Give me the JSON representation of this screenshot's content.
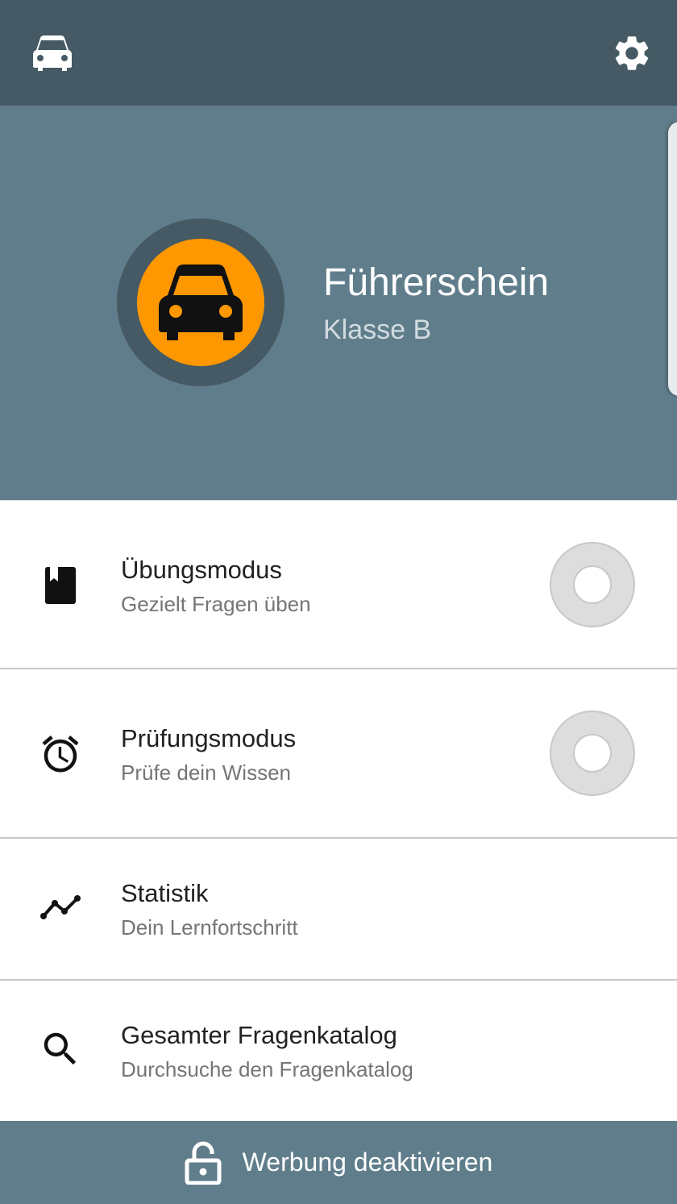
{
  "colors": {
    "toolbar_bg": "#455a64",
    "header_bg": "#607d8b",
    "accent": "#ff9800",
    "footer_bg": "#607d8b",
    "progress_ring": "#dddddd"
  },
  "toolbar": {
    "left_icon": "car-icon",
    "right_icon": "gear-icon"
  },
  "header": {
    "avatar_icon": "car-icon",
    "title": "Führerschein",
    "subtitle": "Klasse B"
  },
  "menu": [
    {
      "icon": "book-icon",
      "title": "Übungsmodus",
      "subtitle": "Gezielt Fragen üben",
      "progress": 0
    },
    {
      "icon": "alarm-clock-icon",
      "title": "Prüfungsmodus",
      "subtitle": "Prüfe dein Wissen",
      "progress": 0
    },
    {
      "icon": "trend-chart-icon",
      "title": "Statistik",
      "subtitle": "Dein Lernfortschritt"
    },
    {
      "icon": "search-icon",
      "title": "Gesamter Fragenkatalog",
      "subtitle": "Durchsuche den Fragenkatalog"
    }
  ],
  "footer": {
    "icon": "lock-open-icon",
    "label": "Werbung deaktivieren"
  }
}
